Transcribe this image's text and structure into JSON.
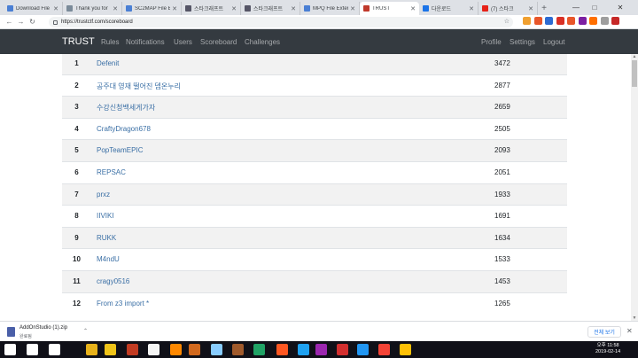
{
  "browser": {
    "tabs": [
      {
        "label": "Download File",
        "icon": "doc-icon",
        "color": "#4a7fd4"
      },
      {
        "label": "Thank you for",
        "icon": "search-icon",
        "color": "#7a8a99"
      },
      {
        "label": "SC2MAP File E",
        "icon": "doc-icon",
        "color": "#4a7fd4"
      },
      {
        "label": "스타크래프트",
        "icon": "blizzard-icon",
        "color": "#556"
      },
      {
        "label": "스타크래프트",
        "icon": "blizzard-icon",
        "color": "#556"
      },
      {
        "label": "MPQ File Exten",
        "icon": "doc-icon",
        "color": "#4a7fd4"
      },
      {
        "label": "TRUST",
        "icon": "flag-icon",
        "color": "#c0392b",
        "active": true
      },
      {
        "label": "다운로드",
        "icon": "download-icon",
        "color": "#1a73e8"
      },
      {
        "label": "(7) 스타크",
        "icon": "youtube-icon",
        "color": "#e62117"
      }
    ],
    "url": "https://trustctf.com/scoreboard",
    "extensions": [
      {
        "icon": "extension-icon",
        "color": "#f0a030"
      },
      {
        "icon": "extension-icon",
        "color": "#e8562a"
      },
      {
        "icon": "extension-icon",
        "color": "#2d6bd2"
      },
      {
        "icon": "extension-icon",
        "color": "#d93025"
      },
      {
        "icon": "extension-icon",
        "color": "#e8562a"
      },
      {
        "icon": "extension-icon",
        "color": "#7b1fa2"
      },
      {
        "icon": "extension-icon",
        "color": "#ff6f00"
      },
      {
        "icon": "extension-icon",
        "color": "#9e9e9e"
      },
      {
        "icon": "extension-icon",
        "color": "#c62828"
      }
    ]
  },
  "site": {
    "brand": "TRUST",
    "nav_left": [
      "Rules",
      "Notifications",
      "Users",
      "Scoreboard",
      "Challenges"
    ],
    "nav_right": [
      "Profile",
      "Settings",
      "Logout"
    ]
  },
  "scoreboard": [
    {
      "rank": "1",
      "name": "Defenit",
      "score": "3472"
    },
    {
      "rank": "2",
      "name": "공주대 영재 떨어진 뎁온누리",
      "score": "2877"
    },
    {
      "rank": "3",
      "name": "수강신청백세게가자",
      "score": "2659"
    },
    {
      "rank": "4",
      "name": "CraftyDragon678",
      "score": "2505"
    },
    {
      "rank": "5",
      "name": "PopTeamEPIC",
      "score": "2093"
    },
    {
      "rank": "6",
      "name": "REPSAC",
      "score": "2051"
    },
    {
      "rank": "7",
      "name": "prxz",
      "score": "1933"
    },
    {
      "rank": "8",
      "name": "IIVIKI",
      "score": "1691"
    },
    {
      "rank": "9",
      "name": "RUKK",
      "score": "1634"
    },
    {
      "rank": "10",
      "name": "M4ndU",
      "score": "1533"
    },
    {
      "rank": "11",
      "name": "cragy0516",
      "score": "1453"
    },
    {
      "rank": "12",
      "name": "From z3 import *",
      "score": "1265"
    }
  ],
  "download": {
    "filename": "AddOnStudio (1).zip",
    "status": "완료됨",
    "show_all": "전체 보기"
  },
  "taskbar": {
    "time_period": "오후",
    "time": "11:58",
    "date": "2019-02-14"
  }
}
